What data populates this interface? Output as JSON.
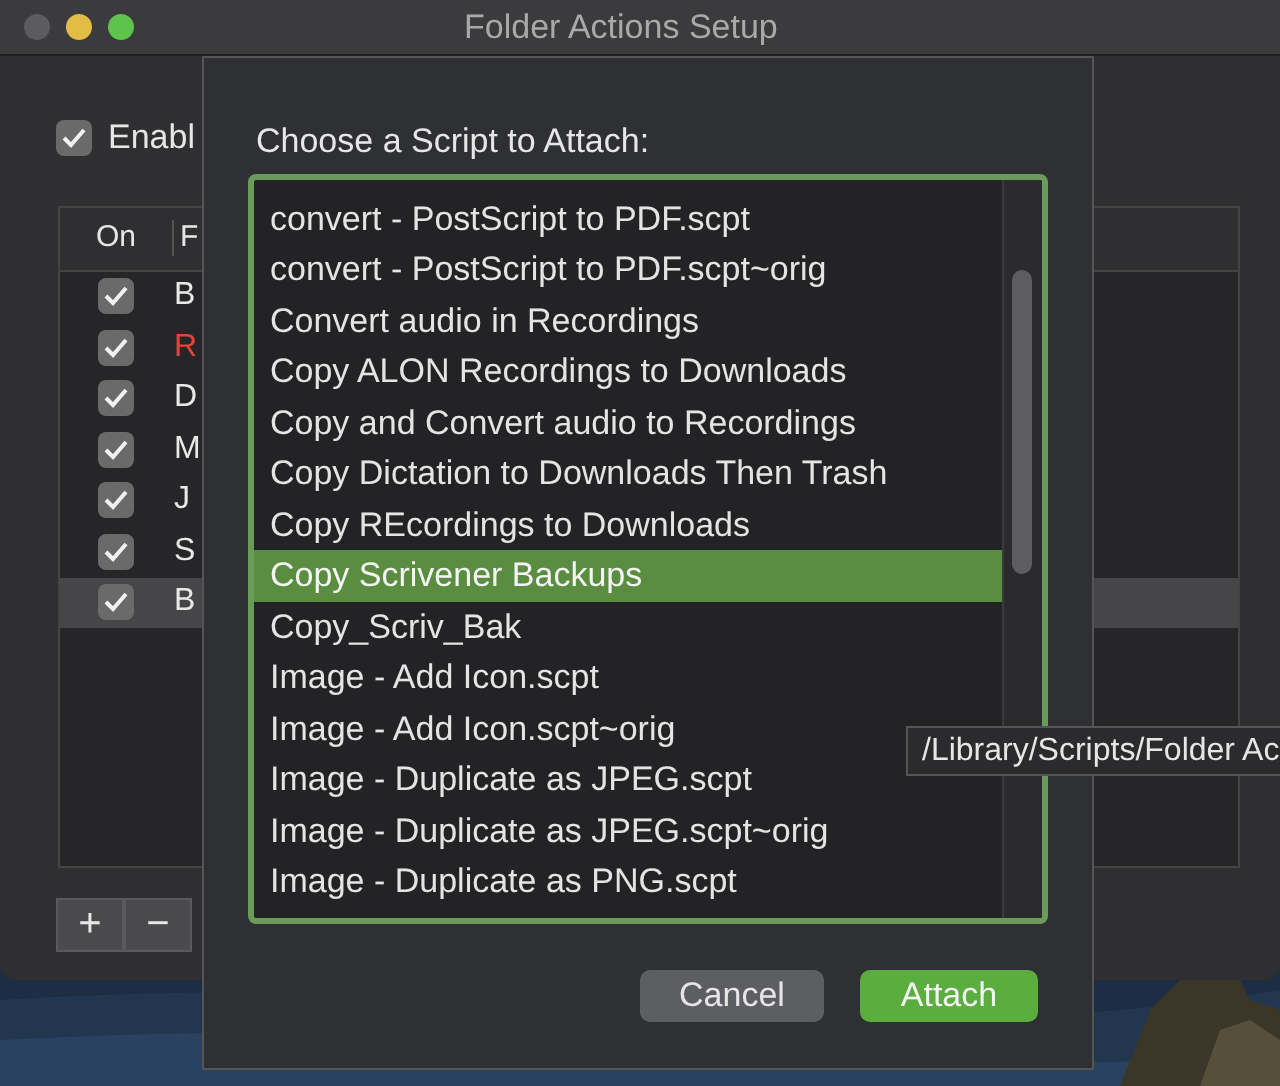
{
  "window": {
    "title": "Folder Actions Setup"
  },
  "enable": {
    "label": "Enabl",
    "checked": true
  },
  "table": {
    "columns": [
      "On",
      "F"
    ],
    "rows": [
      {
        "checked": true,
        "text": "B",
        "color": "#e8e8e8",
        "selected": false
      },
      {
        "checked": true,
        "text": "R",
        "color": "#e0443a",
        "selected": false
      },
      {
        "checked": true,
        "text": "D",
        "color": "#e8e8e8",
        "selected": false
      },
      {
        "checked": true,
        "text": "M",
        "color": "#e8e8e8",
        "selected": false
      },
      {
        "checked": true,
        "text": "J",
        "color": "#e8e8e8",
        "selected": false
      },
      {
        "checked": true,
        "text": "S",
        "color": "#e8e8e8",
        "selected": false
      },
      {
        "checked": true,
        "text": "B",
        "color": "#e8e8e8",
        "selected": true
      }
    ]
  },
  "table_buttons": [
    "+",
    "−"
  ],
  "dialog": {
    "label": "Choose a Script to Attach:",
    "scripts": [
      {
        "name": "convert - PostScript to PDF.scpt",
        "selected": false
      },
      {
        "name": "convert - PostScript to PDF.scpt~orig",
        "selected": false
      },
      {
        "name": "Convert audio in Recordings",
        "selected": false
      },
      {
        "name": "Copy ALON Recordings to Downloads",
        "selected": false
      },
      {
        "name": "Copy and Convert audio to Recordings",
        "selected": false
      },
      {
        "name": "Copy Dictation to Downloads Then Trash",
        "selected": false
      },
      {
        "name": "Copy REcordings to Downloads",
        "selected": false
      },
      {
        "name": "Copy Scrivener Backups",
        "selected": true
      },
      {
        "name": "Copy_Scriv_Bak",
        "selected": false
      },
      {
        "name": "Image - Add Icon.scpt",
        "selected": false
      },
      {
        "name": "Image - Add Icon.scpt~orig",
        "selected": false
      },
      {
        "name": "Image - Duplicate as JPEG.scpt",
        "selected": false
      },
      {
        "name": "Image - Duplicate as JPEG.scpt~orig",
        "selected": false
      },
      {
        "name": "Image - Duplicate as PNG.scpt",
        "selected": false
      }
    ],
    "buttons": [
      {
        "label": "Cancel",
        "kind": "secondary"
      },
      {
        "label": "Attach",
        "kind": "primary"
      }
    ]
  },
  "tooltip": "/Library/Scripts/Folder Ac"
}
